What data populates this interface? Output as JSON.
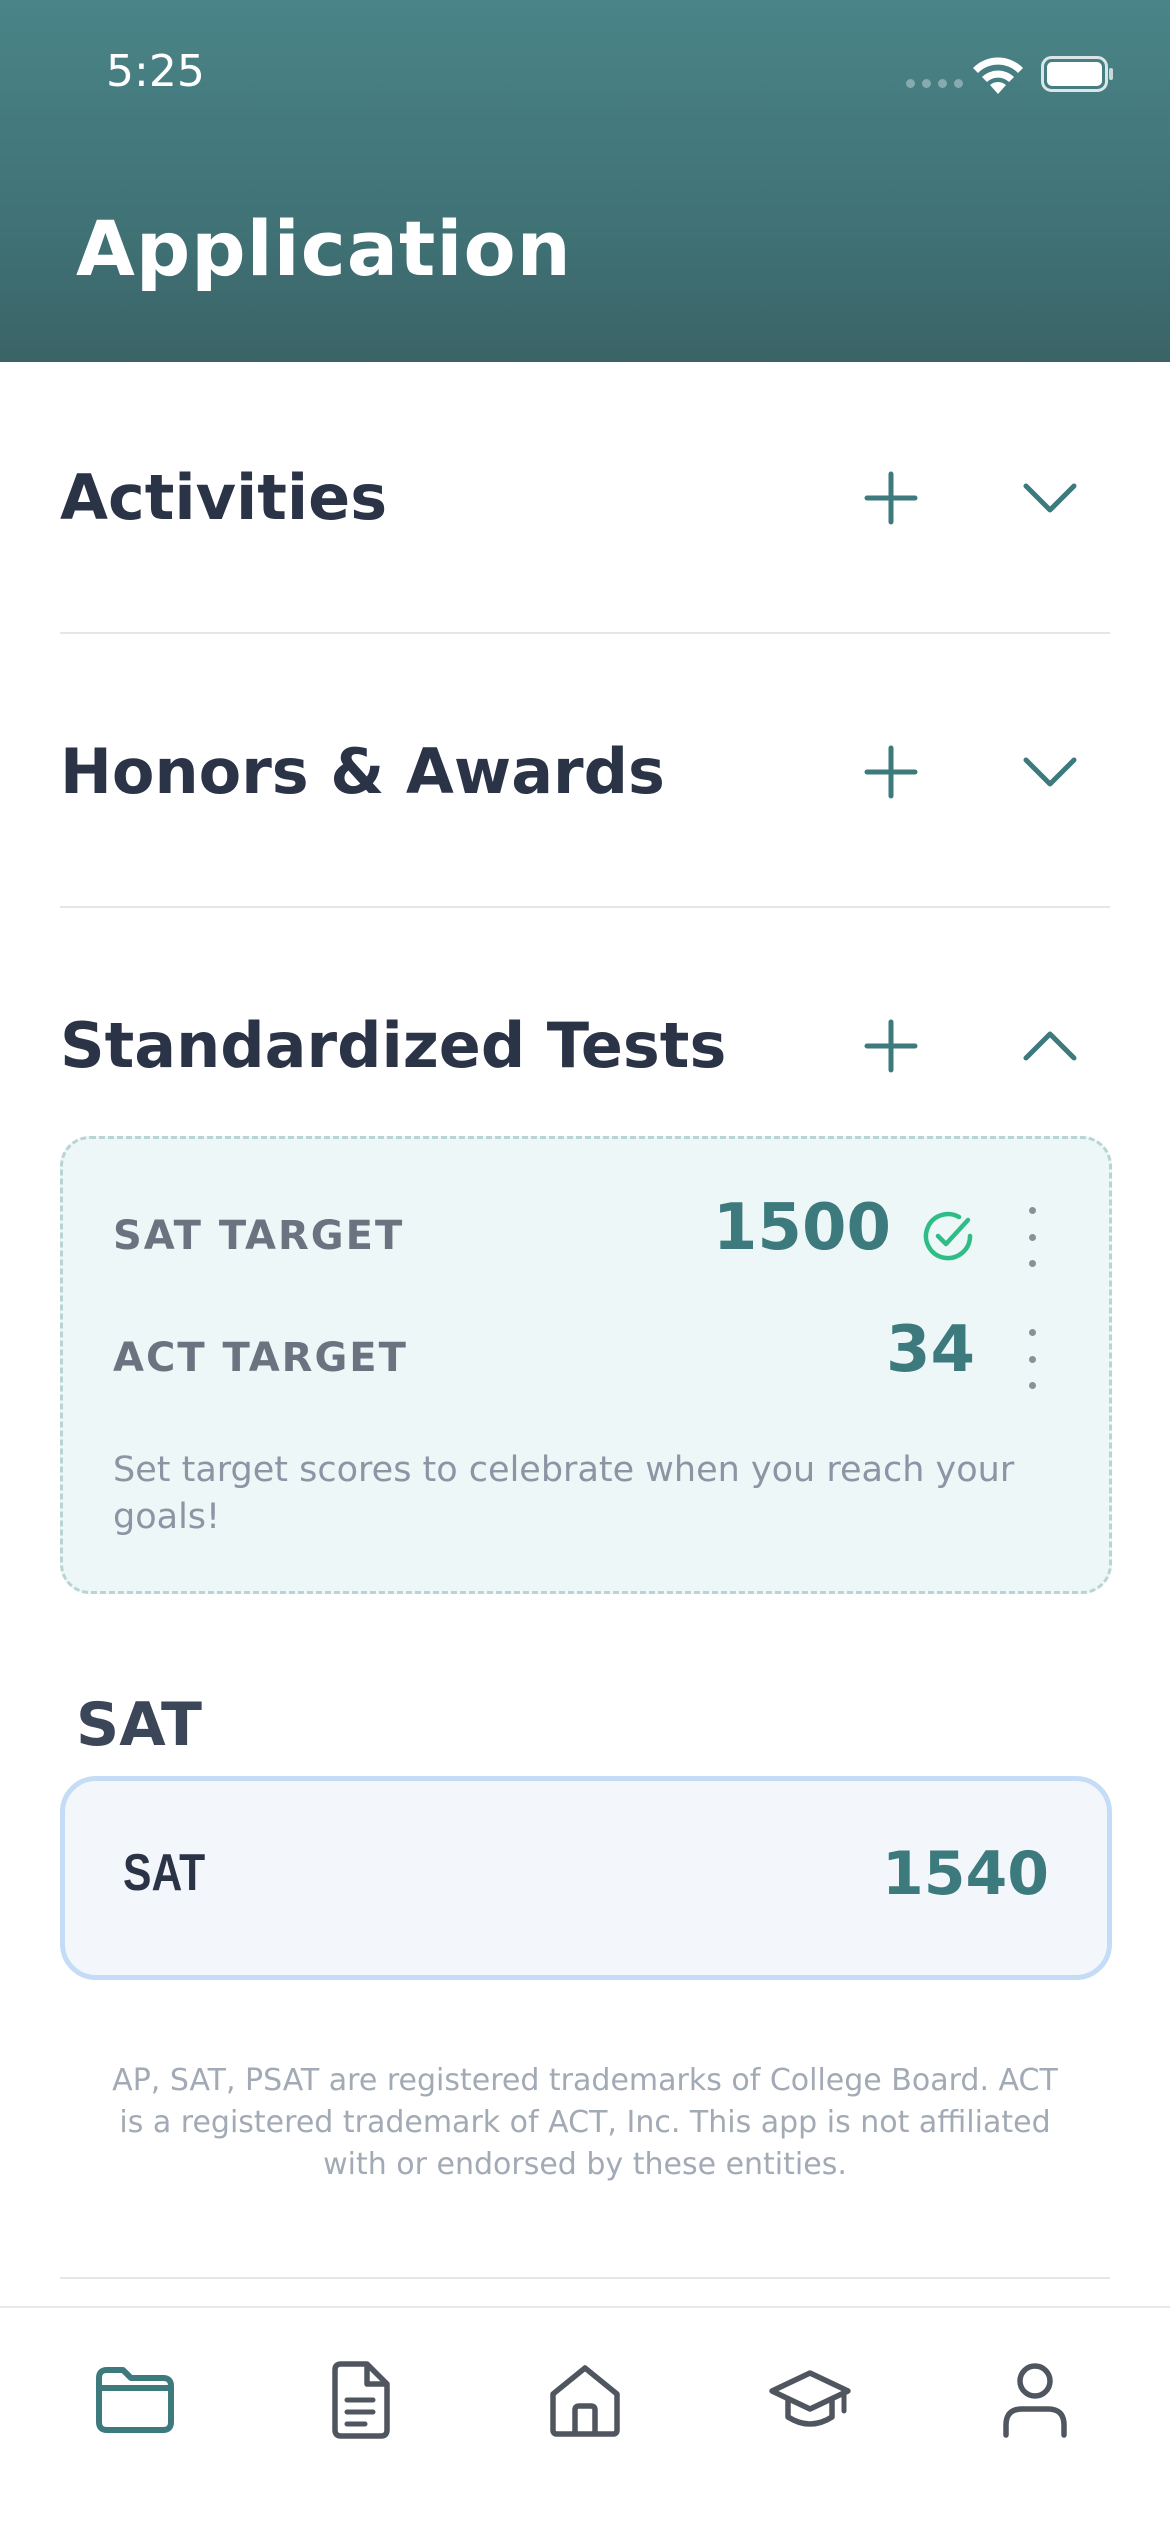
{
  "status_bar": {
    "time": "5:25"
  },
  "header": {
    "title": "Application"
  },
  "sections": {
    "activities": {
      "title": "Activities",
      "expanded": false
    },
    "honors": {
      "title": "Honors & Awards",
      "expanded": false
    },
    "tests": {
      "title": "Standardized Tests",
      "expanded": true
    }
  },
  "targets": {
    "sat_label": "SAT TARGET",
    "sat_value": "1500",
    "sat_reached": true,
    "act_label": "ACT TARGET",
    "act_value": "34",
    "note": "Set target scores to celebrate when you reach your goals!"
  },
  "sat_group": {
    "heading": "SAT",
    "card_label": "SAT",
    "card_value": "1540"
  },
  "disclaimer": "AP, SAT, PSAT are registered trademarks of College Board. ACT is a registered trademark of ACT, Inc. This app is not affiliated with or endorsed by these entities.",
  "tabs": [
    {
      "icon": "folder-icon",
      "active": true
    },
    {
      "icon": "document-icon",
      "active": false
    },
    {
      "icon": "home-icon",
      "active": false
    },
    {
      "icon": "graduation-cap-icon",
      "active": false
    },
    {
      "icon": "user-icon",
      "active": false
    }
  ],
  "colors": {
    "accent": "#3d7a7d",
    "header_top": "#4a8488",
    "header_bottom": "#3b6366",
    "success": "#2ebd86"
  }
}
